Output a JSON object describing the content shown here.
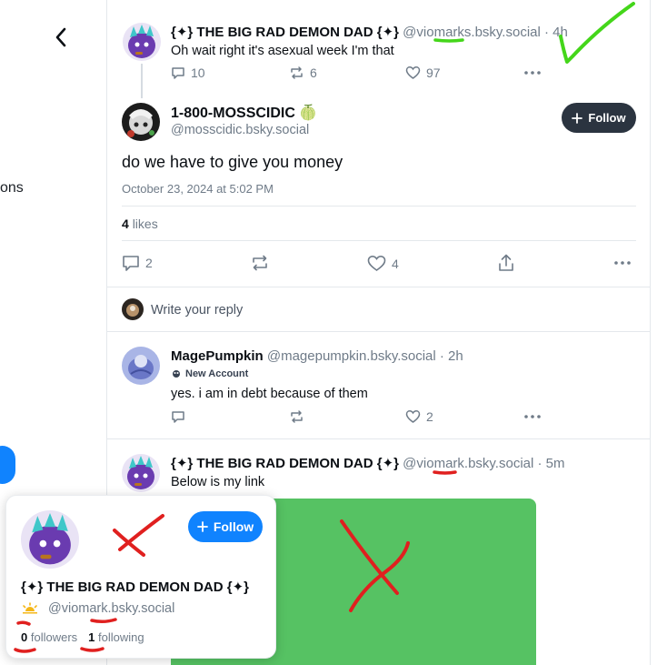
{
  "colors": {
    "accent_blue": "#1083fe",
    "follow_dark": "#2b3440",
    "annotation_green": "#44d61a",
    "annotation_red": "#e0201f",
    "embed_green": "#56c263"
  },
  "sidebar": {
    "partial_label": "ons"
  },
  "parent_post": {
    "display_name": "{✦} THE BIG RAD DEMON DAD {✦}",
    "handle": "@viomarks.bsky.social",
    "time": "· 4h",
    "text": "Oh wait right it's asexual week I'm that",
    "replies": "10",
    "reposts": "6",
    "likes": "97"
  },
  "main_post": {
    "display_name": "1-800-MOSSCIDIC",
    "name_emoji": "🍈",
    "handle": "@mosscidic.bsky.social",
    "follow_label": "Follow",
    "text": "do we have to give you money",
    "timestamp": "October 23, 2024 at 5:02 PM",
    "likes_count": "4",
    "likes_label": "likes",
    "replies": "2",
    "like_action_count": "4"
  },
  "reply_box": {
    "placeholder": "Write your reply"
  },
  "reply1": {
    "display_name": "MagePumpkin",
    "handle": "@magepumpkin.bsky.social",
    "time": "· 2h",
    "badge": "New Account",
    "text": "yes. i am in debt because of them",
    "likes": "2"
  },
  "reply2": {
    "display_name": "{✦} THE BIG RAD DEMON DAD {✦}",
    "handle": "@viomark.bsky.social",
    "time": "· 5m",
    "text": "Below is my link"
  },
  "hover_card": {
    "display_name": "{✦} THE BIG RAD DEMON DAD {✦}",
    "handle": "@viomark.bsky.social",
    "follow_label": "Follow",
    "followers_count": "0",
    "followers_label": "followers",
    "following_count": "1",
    "following_label": "following"
  }
}
